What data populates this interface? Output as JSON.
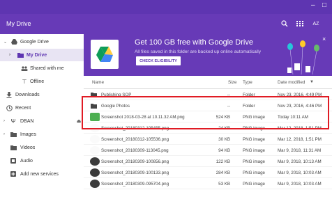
{
  "toolbar": {
    "title": "My Drive",
    "icons": [
      "search-icon",
      "grid-view-icon",
      "sort-az-icon"
    ],
    "sort_label": "AZ"
  },
  "window_controls": [
    "minimize-icon",
    "maximize-icon"
  ],
  "sidebar": {
    "items": [
      {
        "label": "Google Drive",
        "icon": "drive-icon",
        "expand": "v"
      },
      {
        "label": "My Drive",
        "icon": "folder-drive-icon",
        "expand": ">",
        "active": true
      },
      {
        "label": "Shared with me",
        "icon": "people-icon"
      },
      {
        "label": "Offline",
        "icon": "pin-icon"
      },
      {
        "label": "Downloads",
        "icon": "download-icon"
      },
      {
        "label": "Recent",
        "icon": "clock-icon"
      },
      {
        "label": "DBAN",
        "icon": "usb-icon",
        "expand": ">"
      },
      {
        "label": "Images",
        "icon": "folder-icon",
        "expand": ">"
      },
      {
        "label": "Videos",
        "icon": "video-folder-icon"
      },
      {
        "label": "Audio",
        "icon": "audio-icon"
      },
      {
        "label": "Add new services",
        "icon": "add-box-icon"
      }
    ]
  },
  "banner": {
    "title": "Get 100 GB free with Google Drive",
    "subtitle": "All files saved in this folder are backed up online automatically",
    "button": "CHECK ELIGIBILITY",
    "close": "×"
  },
  "table": {
    "headers": {
      "name": "Name",
      "size": "Size",
      "type": "Type",
      "date": "Date modified"
    },
    "rows": [
      {
        "name": "Publishing SOP",
        "size": "--",
        "type": "Folder",
        "date": "Nov 23, 2016, 4:49 PM",
        "icon": "folder"
      },
      {
        "name": "Google Photos",
        "size": "--",
        "type": "Folder",
        "date": "Nov 23, 2016, 4:46 PM",
        "icon": "folder"
      },
      {
        "name": "Screenshot 2018-03-28 at 10.11.32 AM.png",
        "size": "524 KB",
        "type": "PNG image",
        "date": "Today 10:11 AM",
        "icon": "thumb"
      },
      {
        "name": "Screenshot_20180312-105455.png",
        "size": "24 KB",
        "type": "PNG image",
        "date": "Mar 12, 2018, 1:51 PM",
        "icon": "blank"
      },
      {
        "name": "Screenshot_20180312-105536.png",
        "size": "30 KB",
        "type": "PNG image",
        "date": "Mar 12, 2018, 1:51 PM",
        "icon": "blank"
      },
      {
        "name": "Screenshot_20180309-113045.png",
        "size": "94 KB",
        "type": "PNG image",
        "date": "Mar 9, 2018, 11:31 AM",
        "icon": "blank"
      },
      {
        "name": "Screenshot_20180309-100856.png",
        "size": "122 KB",
        "type": "PNG image",
        "date": "Mar 9, 2018, 10:13 AM",
        "icon": "dark"
      },
      {
        "name": "Screenshot_20180309-100133.png",
        "size": "284 KB",
        "type": "PNG image",
        "date": "Mar 9, 2018, 10:03 AM",
        "icon": "dark"
      },
      {
        "name": "Screenshot_20180309-095704.png",
        "size": "53 KB",
        "type": "PNG image",
        "date": "Mar 9, 2018, 10:03 AM",
        "icon": "dark"
      }
    ]
  },
  "colors": {
    "accent": "#673ab7",
    "highlight": "#e01b24"
  }
}
